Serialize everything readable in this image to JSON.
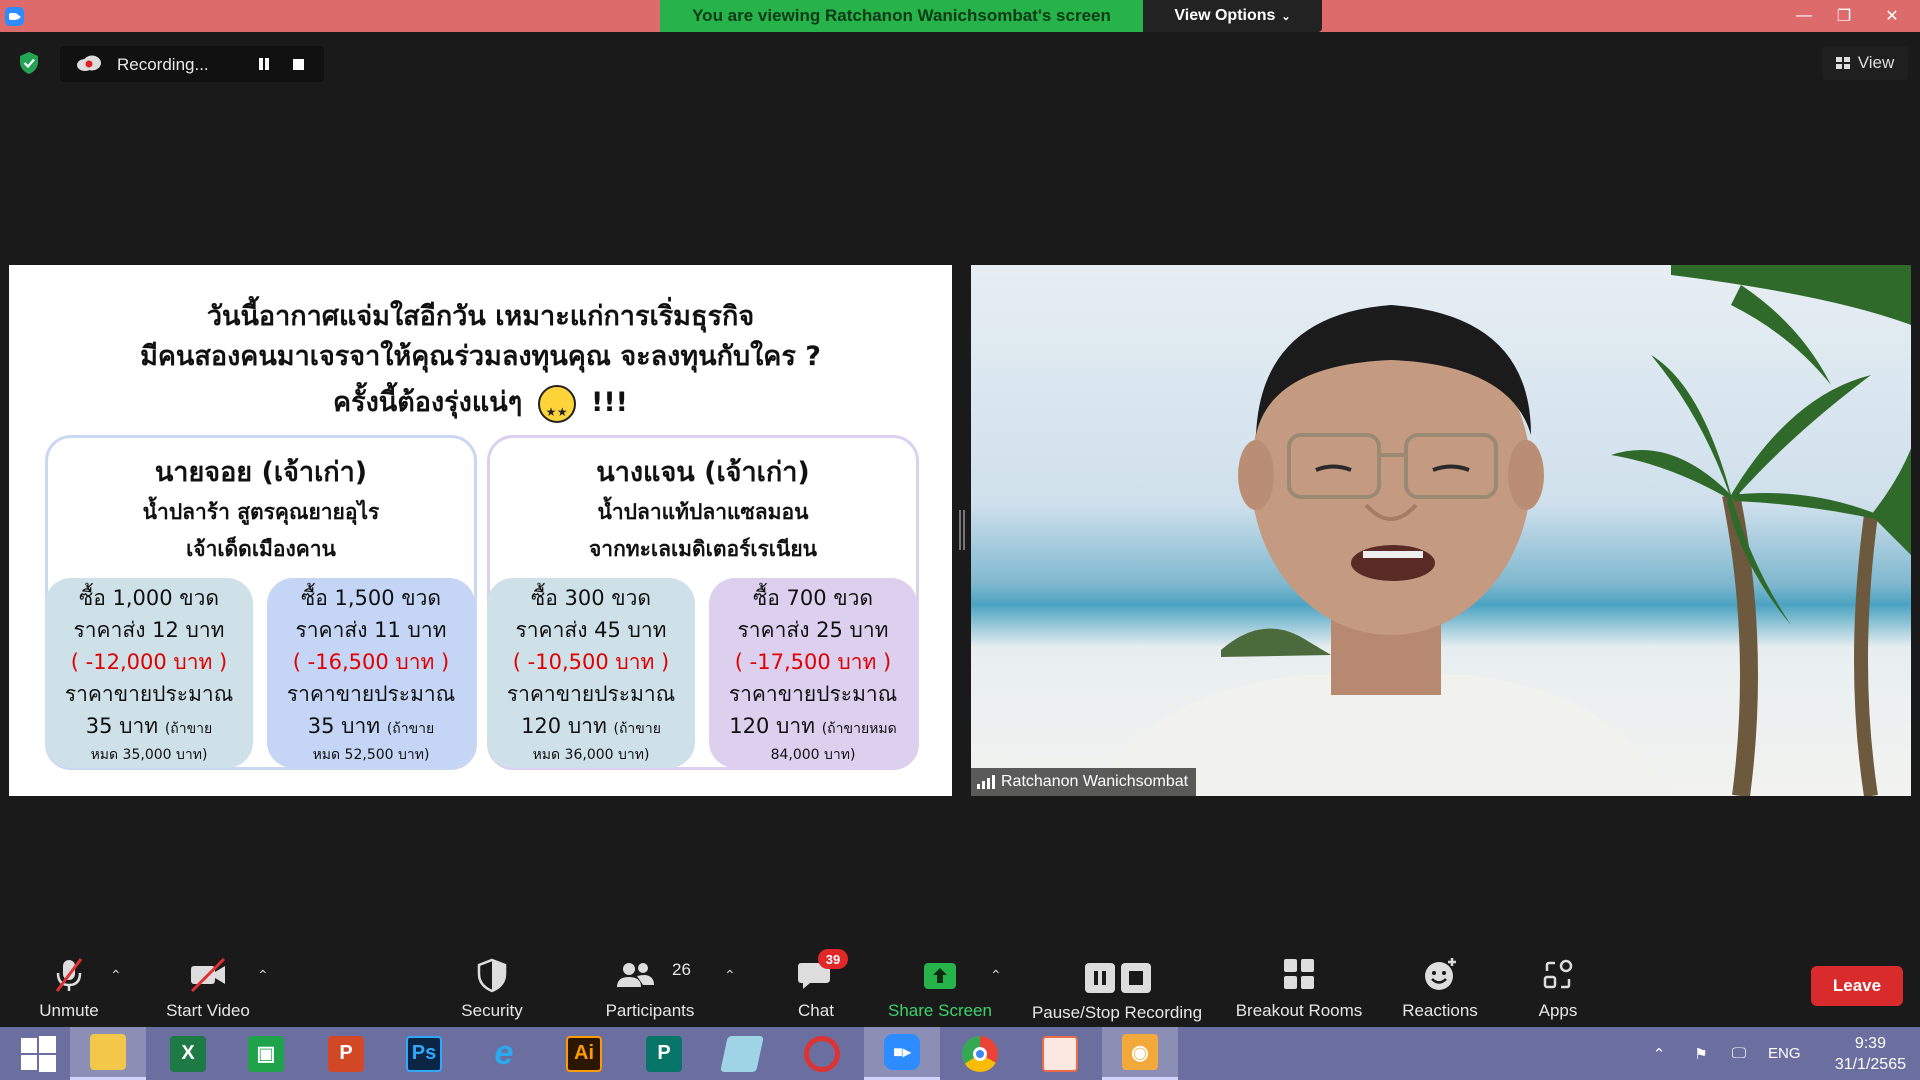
{
  "titlebar": {
    "banner": "You are viewing Ratchanon Wanichsombat's screen",
    "view_options": "View Options",
    "minimize": "—",
    "restore": "❐",
    "close": "✕"
  },
  "recording": {
    "label": "Recording..."
  },
  "view_button": {
    "label": "View"
  },
  "slide": {
    "title_line1": "วันนี้อากาศแจ่มใสอีกวัน เหมาะแก่การเริ่มธุรกิจ",
    "title_line2": "มีคนสองคนมาเจรจาให้คุณร่วมลงทุนคุณ จะลงทุนกับใคร ?",
    "title_line3a": "ครั้งนี้ต้องรุ่งแน่ๆ",
    "title_line3b": "!!!",
    "left": {
      "name": "นายจอย (เจ้าเก่า)",
      "sub1": "น้ำปลาร้า สูตรคุณยายอุไร",
      "sub2": "เจ้าเด็ดเมืองคาน",
      "box1": {
        "l1": "ซื้อ 1,000 ขวด",
        "l2": "ราคาส่ง 12 บาท",
        "l3": "( -12,000 บาท )",
        "l4": "ราคาขายประมาณ",
        "l5": "35 บาท",
        "l5s": "(ถ้าขาย",
        "l6": "หมด 35,000 บาท)"
      },
      "box2": {
        "l1": "ซื้อ 1,500 ขวด",
        "l2": "ราคาส่ง 11 บาท",
        "l3": "( -16,500 บาท )",
        "l4": "ราคาขายประมาณ",
        "l5": "35 บาท",
        "l5s": "(ถ้าขาย",
        "l6": "หมด 52,500 บาท)"
      }
    },
    "right": {
      "name": "นางแจน (เจ้าเก่า)",
      "sub1": "น้ำปลาแท้ปลาแซลมอน",
      "sub2": "จากทะเลเมดิเตอร์เรเนียน",
      "box1": {
        "l1": "ซื้อ 300 ขวด",
        "l2": "ราคาส่ง 45 บาท",
        "l3": "( -10,500 บาท )",
        "l4": "ราคาขายประมาณ",
        "l5": "120 บาท",
        "l5s": "(ถ้าขาย",
        "l6": "หมด 36,000 บาท)"
      },
      "box2": {
        "l1": "ซื้อ 700 ขวด",
        "l2": "ราคาส่ง 25 บาท",
        "l3": "( -17,500 บาท )",
        "l4": "ราคาขายประมาณ",
        "l5": "120 บาท",
        "l5s": "(ถ้าขายหมด",
        "l6": "84,000 บาท)"
      }
    }
  },
  "video": {
    "participant_name": "Ratchanon Wanichsombat"
  },
  "toolbar": {
    "unmute": "Unmute",
    "start_video": "Start Video",
    "security": "Security",
    "participants": "Participants",
    "participants_count": "26",
    "chat": "Chat",
    "chat_badge": "39",
    "share_screen": "Share Screen",
    "pause_stop_recording": "Pause/Stop Recording",
    "breakout_rooms": "Breakout Rooms",
    "reactions": "Reactions",
    "apps": "Apps",
    "leave": "Leave"
  },
  "taskbar": {
    "apps": [
      "windows-start",
      "file-explorer",
      "excel",
      "publisher-green",
      "powerpoint",
      "photoshop",
      "internet-explorer",
      "illustrator",
      "publisher",
      "notepad",
      "hoto-cape",
      "zoom",
      "chrome",
      "photos",
      "camera"
    ],
    "ps_label": "Ps",
    "ai_label": "Ai",
    "language": "ENG",
    "time": "9:39",
    "date": "31/1/2565"
  },
  "colors": {
    "zoom_blue": "#2d8cff",
    "leave_red": "#d92b2b",
    "share_green": "#26b34a",
    "banner_green": "#26b34a",
    "titlebar_red": "#dd6b6b"
  }
}
